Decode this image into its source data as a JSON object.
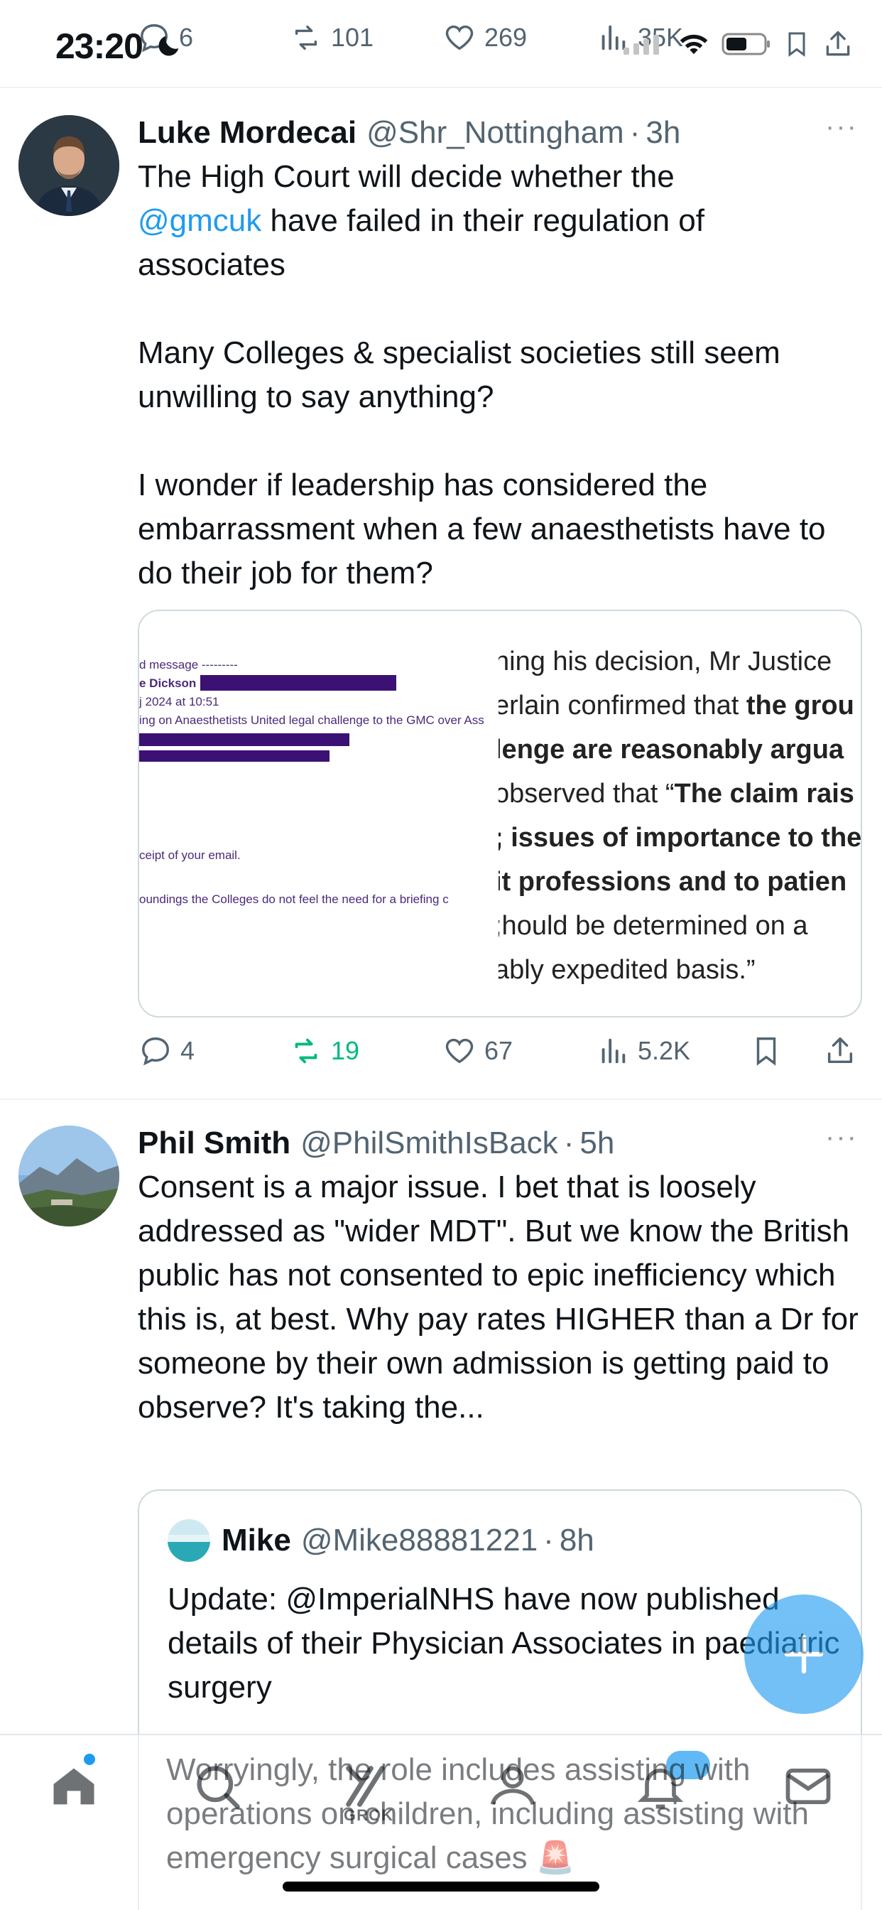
{
  "status_bar": {
    "time": "23:20"
  },
  "prev_tweet_actions": {
    "replies": "6",
    "reposts": "101",
    "likes": "269",
    "views": "35K"
  },
  "tweets": [
    {
      "name": "Luke Mordecai",
      "handle": "@Shr_Nottingham",
      "separator": "·",
      "time": "3h",
      "more": "···",
      "text_line1_pre": "The High Court will decide whether the",
      "mention": "@gmcuk",
      "text_line2_post": " have failed in their regulation of",
      "text_line3": "associates",
      "para2": "Many Colleges & specialist societies still seem unwilling to say anything?",
      "para3": "I wonder if leadership has considered the embarrassment when a few anaesthetists have to do their job for them?",
      "media": {
        "left_lines": [
          "d message ---------",
          "e Dickson",
          "j 2024 at 10:51",
          "ing on Anaesthetists United legal challenge to the GMC over Ass",
          "ceipt of your email.",
          "oundings the Colleges do not feel the need for a briefing c"
        ],
        "right_lines": [
          {
            "plain": "ning his decision, Mr Justice",
            "bold": ""
          },
          {
            "plain": "erlain confirmed that ",
            "bold": "the grou"
          },
          {
            "plain": "",
            "bold": "lenge are reasonably argua"
          },
          {
            "plain": "observed that “",
            "bold": "The claim rais"
          },
          {
            "plain": "",
            "bold": "; issues of importance to the"
          },
          {
            "plain": "",
            "bold": "it professions and to patien"
          },
          {
            "plain": ";hould be determined on a",
            "bold": ""
          },
          {
            "plain": "ably expedited basis.”",
            "bold": ""
          }
        ]
      },
      "actions": {
        "replies": "4",
        "reposts": "19",
        "likes": "67",
        "views": "5.2K"
      }
    },
    {
      "name": "Phil Smith",
      "handle": "@PhilSmithIsBack",
      "separator": "·",
      "time": "5h",
      "more": "···",
      "text": "Consent is a major issue. I bet that is loosely addressed as \"wider MDT\". But we know the British public has not consented to epic inefficiency which this is, at best. Why pay rates HIGHER than a Dr for someone by their own admission is getting paid to observe? It's taking the...",
      "quote": {
        "name": "Mike",
        "handle": "@Mike88881221",
        "separator": "·",
        "time": "8h",
        "text": "Update: @ImperialNHS have now published details of their Physician Associates in paediatric surgery"
      }
    }
  ],
  "overlay_text": "Worryingly, the role includes assisting with operations on children, including assisting with emergency surgical cases 🚨",
  "bottom_nav": {
    "grok_label": "GROK",
    "items": [
      "home-icon",
      "search-icon",
      "grok-icon",
      "communities-icon",
      "notifications-icon",
      "messages-icon"
    ]
  },
  "colors": {
    "accent": "#1d9bf0",
    "repost_active": "#00ba7c",
    "muted": "#536471"
  }
}
